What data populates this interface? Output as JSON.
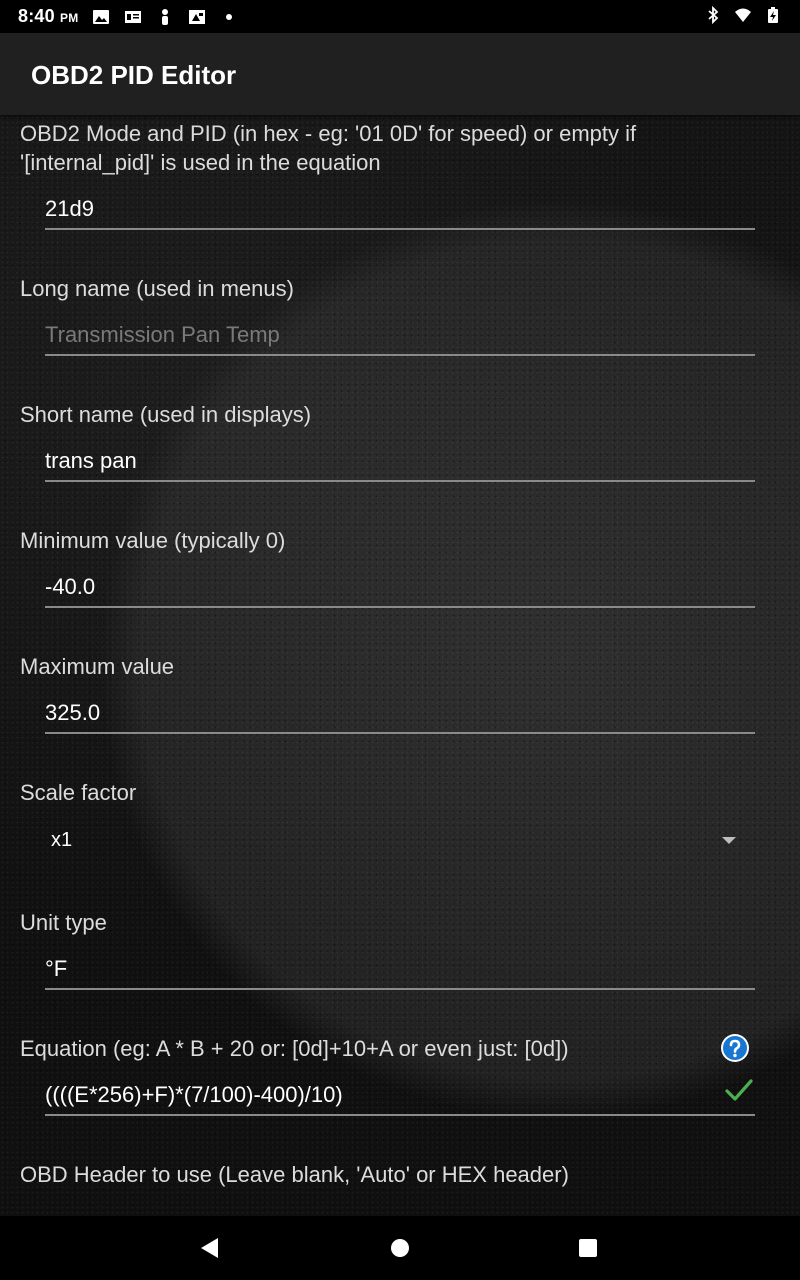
{
  "status_bar": {
    "time": "8:40",
    "ampm": "PM"
  },
  "app_bar": {
    "title": "OBD2 PID Editor"
  },
  "fields": {
    "pid": {
      "label": "OBD2 Mode and PID (in hex - eg: '01 0D' for speed) or empty if '[internal_pid]' is used in the equation",
      "value": "21d9"
    },
    "long_name": {
      "label": "Long name (used in menus)",
      "placeholder": "Transmission Pan Temp"
    },
    "short_name": {
      "label": "Short name (used in displays)",
      "value": "trans pan"
    },
    "min_value": {
      "label": "Minimum value (typically 0)",
      "value": "-40.0"
    },
    "max_value": {
      "label": "Maximum value",
      "value": "325.0"
    },
    "scale_factor": {
      "label": "Scale factor",
      "selected": "x1"
    },
    "unit_type": {
      "label": "Unit type",
      "value": "°F"
    },
    "equation": {
      "label": "Equation (eg:  A * B + 20   or: [0d]+10+A  or even just: [0d])",
      "value": "((((E*256)+F)*(7/100)-400)/10)"
    },
    "obd_header": {
      "label": "OBD Header to use (Leave blank, 'Auto' or HEX header)"
    }
  },
  "colors": {
    "accent_blue": "#1976d2",
    "valid_green": "#4caf50",
    "app_bar": "#202020"
  }
}
